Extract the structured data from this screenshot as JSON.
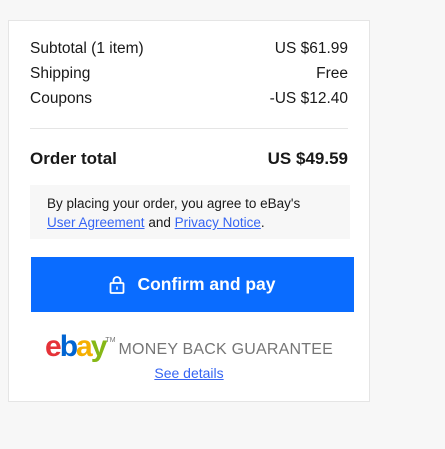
{
  "summary": {
    "subtotal_label": "Subtotal (1 item)",
    "subtotal_value": "US $61.99",
    "shipping_label": "Shipping",
    "shipping_value": "Free",
    "coupons_label": "Coupons",
    "coupons_value": "-US $12.40",
    "total_label": "Order total",
    "total_value": "US $49.59"
  },
  "notice": {
    "text_before": "By placing your order, you agree to eBay's",
    "user_agreement": "User Agreement",
    "and": "and",
    "privacy_notice": "Privacy Notice",
    "period": "."
  },
  "confirm_button": {
    "label": "Confirm and pay",
    "icon": "lock-icon",
    "color": "#0a6cff"
  },
  "guarantee": {
    "logo_e": "e",
    "logo_b": "b",
    "logo_a": "a",
    "logo_y": "y",
    "tm": "TM",
    "text": "MONEY BACK GUARANTEE",
    "link": "See details"
  },
  "colors": {
    "link": "#3665f3",
    "background": "#f7f7f7"
  }
}
